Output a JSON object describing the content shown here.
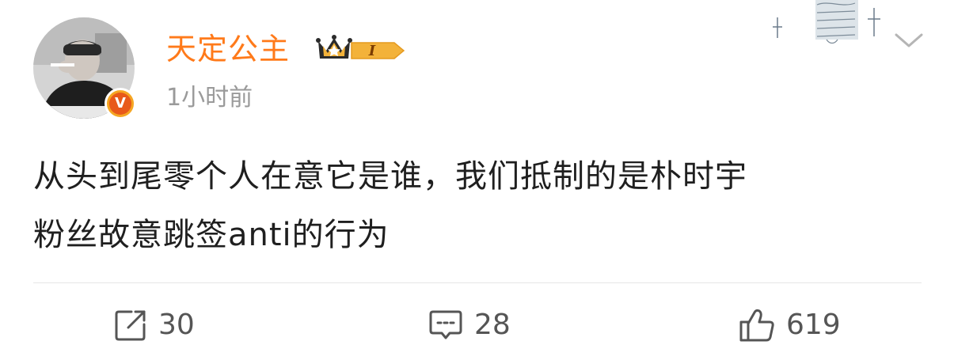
{
  "post": {
    "username": "天定公主",
    "vip_level": "I",
    "timestamp": "1小时前",
    "verified_mark": "V",
    "text_line1": "从头到尾零个人在意它是谁，我们抵制的是朴时宇",
    "text_line2": "粉丝故意跳签anti的行为"
  },
  "actions": {
    "repost_count": "30",
    "comment_count": "28",
    "like_count": "619"
  },
  "colors": {
    "username": "#ff7a1a",
    "verified_outer": "#f5a623",
    "verified_inner": "#e8591a",
    "vip_gold": "#f3b23a",
    "timestamp": "#9a9a9a",
    "icon_gray": "#555555"
  },
  "icons": {
    "repost": "share-edit-icon",
    "comment": "comment-icon",
    "like": "thumbs-up-icon",
    "menu": "chevron-down-icon",
    "vip": "crown-badge-icon"
  }
}
